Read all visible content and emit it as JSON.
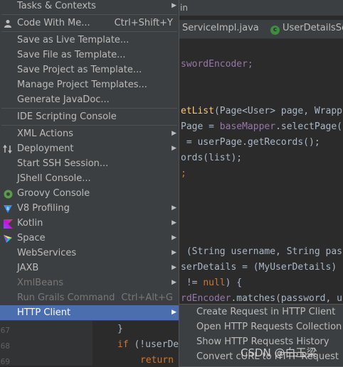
{
  "window": {
    "title_fragment": "in"
  },
  "tabs": [
    {
      "label": "ServiceImpl.java"
    },
    {
      "label": "UserDetailsSer"
    }
  ],
  "tab_icon_letter": "c",
  "code_lines": [
    "swordEncoder;",
    "etList(Page<User> page, Wrapp",
    "Page = baseMapper.selectPage(",
    " = userPage.getRecords();",
    "ords(list);",
    ";",
    " (String username, String pass",
    "serDetails = (MyUserDetails)",
    " != null) {",
    "rdEncoder.matches(password, u",
    "}",
    "if (!userDe",
    "return"
  ],
  "line_numbers": [
    "67",
    "68",
    "69"
  ],
  "menu": {
    "items": [
      {
        "label": "Tasks & Contexts",
        "submenu": true
      },
      {
        "label": "Code With Me...",
        "shortcut": "Ctrl+Shift+Y",
        "icon": "person-icon"
      },
      {
        "label": "Save as Live Template..."
      },
      {
        "label": "Save File as Template..."
      },
      {
        "label": "Save Project as Template..."
      },
      {
        "label": "Manage Project Templates..."
      },
      {
        "label": "Generate JavaDoc..."
      },
      {
        "label": "IDE Scripting Console"
      },
      {
        "label": "XML Actions",
        "submenu": true
      },
      {
        "label": "Deployment",
        "submenu": true,
        "icon": "deployment-icon"
      },
      {
        "label": "Start SSH Session..."
      },
      {
        "label": "JShell Console..."
      },
      {
        "label": "Groovy Console",
        "icon": "groovy-icon"
      },
      {
        "label": "V8 Profiling",
        "submenu": true,
        "icon": "v8-icon"
      },
      {
        "label": "Kotlin",
        "submenu": true,
        "icon": "kotlin-icon"
      },
      {
        "label": "Space",
        "submenu": true,
        "icon": "space-icon"
      },
      {
        "label": "WebServices",
        "submenu": true
      },
      {
        "label": "JAXB",
        "submenu": true
      },
      {
        "label": "XmlBeans",
        "submenu": true,
        "disabled": true
      },
      {
        "label": "Run Grails Command",
        "shortcut": "Ctrl+Alt+G",
        "disabled": true
      },
      {
        "label": "HTTP Client",
        "submenu": true,
        "selected": true
      }
    ]
  },
  "submenu": {
    "items": [
      {
        "label": "Create Request in HTTP Client"
      },
      {
        "label": "Open HTTP Requests Collection"
      },
      {
        "label": "Show HTTP Requests History"
      },
      {
        "label": "Convert cURL to HTTP Request"
      }
    ]
  },
  "watermark": "CSDN @白玉梁",
  "colors": {
    "menu_bg": "#3c3f41",
    "selected_bg": "#4b6eaf",
    "editor_bg": "#2b2b2b",
    "keyword": "#cc7832",
    "function": "#ffc66d"
  }
}
